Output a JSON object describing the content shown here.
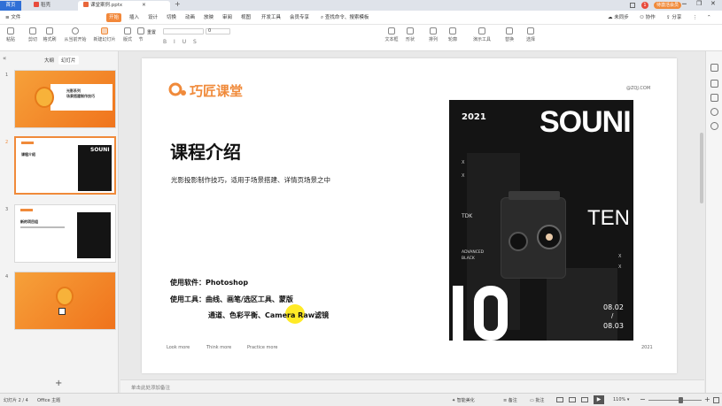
{
  "tabs": {
    "home": "首页",
    "draft": "稻壳",
    "active": "课堂案例.pptx",
    "plus": "+"
  },
  "titlebar": {
    "badge": "1",
    "user": "待激活会员"
  },
  "menu": {
    "file": "≡ 文件",
    "items": [
      "开始",
      "插入",
      "设计",
      "切换",
      "动画",
      "放映",
      "审阅",
      "视图",
      "开发工具",
      "会员专享"
    ],
    "search": "查找命令、搜索模板",
    "share": "未同步",
    "collab": "协作",
    "sharebtn": "分享"
  },
  "toolbar": {
    "buttons": [
      "粘贴",
      "剪切",
      "格式刷",
      "从当前开始",
      "新建幻灯片",
      "版式",
      "节",
      "重置"
    ],
    "zero": "0",
    "right_buttons": [
      "文本框",
      "形状",
      "排列",
      "轮廓",
      "演示工具",
      "替换",
      "选择"
    ]
  },
  "leftpanel": {
    "tab_outline": "大纲",
    "tab_slides": "幻灯片",
    "nums": [
      "1",
      "2",
      "3",
      "4"
    ],
    "add": "+"
  },
  "thumbs": {
    "t1_title": "光影系列",
    "t1_sub": "场景搭建制作技巧",
    "t2_title": "课程介绍",
    "t3_title": "新的项目组"
  },
  "slide": {
    "logo": "巧匠课堂",
    "website": "@ZQJ.COM",
    "title": "课程介绍",
    "subtitle": "光影投影制作技巧，适用于场景搭建、详情页场景之中",
    "software_label": "使用软件：",
    "software": "Photoshop",
    "tools_label": "使用工具：",
    "tools_line1": "曲线、画笔/选区工具、蒙版",
    "tools_line2": "通道、色彩平衡、Camera Raw滤镜",
    "links": [
      "Look more",
      "Think more",
      "Practice more"
    ],
    "year_bottom": "2021"
  },
  "poster": {
    "year": "2021",
    "big": "SOUNI",
    "ten": "TEN",
    "tdk": "TDK",
    "advanced": "ADVANCED",
    "black": "BLACK",
    "x": "X",
    "date1": "08.02",
    "slash": "/",
    "date2": "08.03"
  },
  "notes": {
    "placeholder": "单击此处添加备注"
  },
  "status": {
    "slide": "幻灯片 2 / 4",
    "theme": "Office 主题",
    "beautify": "智能美化",
    "notes": "备注",
    "comment": "批注",
    "zoom": "110%"
  },
  "colors": {
    "accent": "#f08a3a",
    "brand_blue": "#2f6fd6",
    "poster_bg": "#141414"
  }
}
